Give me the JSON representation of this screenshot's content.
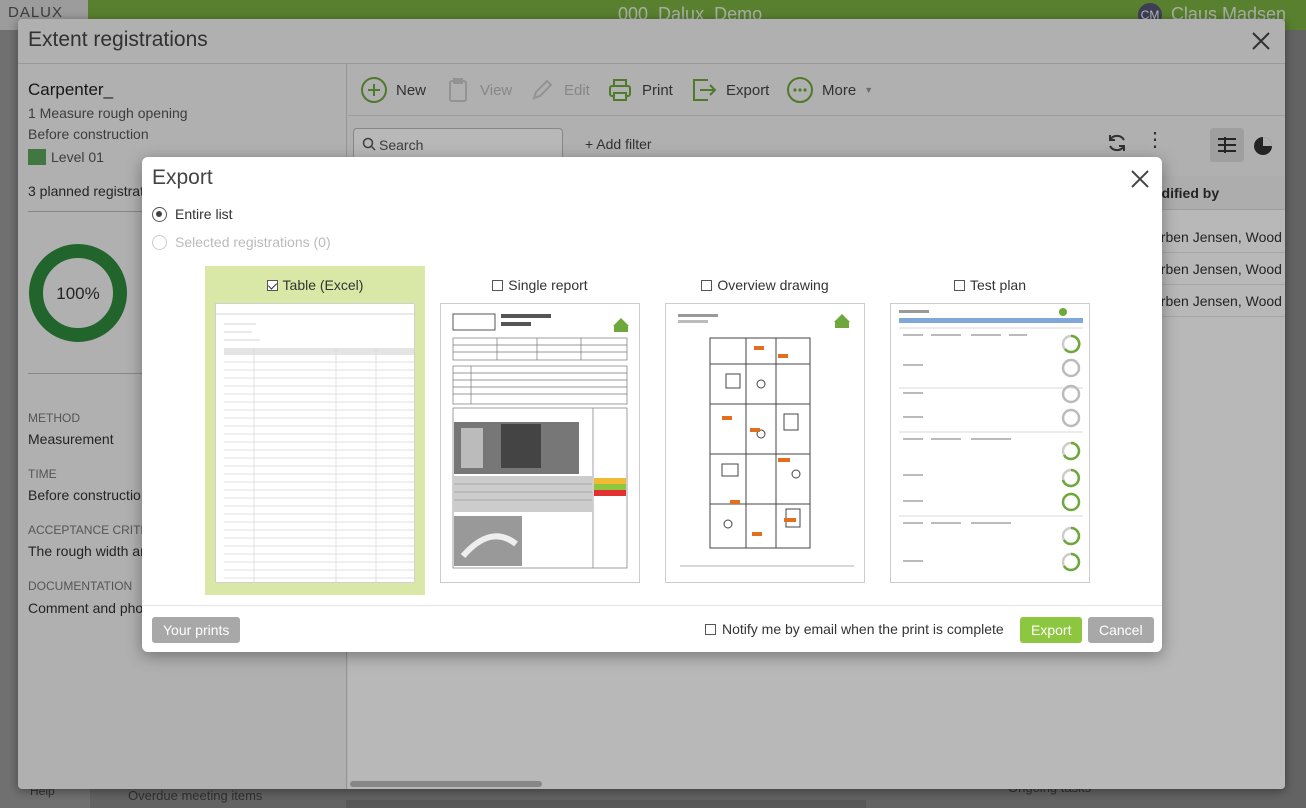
{
  "app": {
    "logo": "DALUX",
    "project": "000_Dalux_Demo",
    "user_initials": "CM",
    "user_name": "Claus Madsen",
    "help": "Help",
    "bottom_item": "Overdue meeting items",
    "bottom_item_right": "Ongoing tasks"
  },
  "window": {
    "title": "Extent registrations"
  },
  "left_pane": {
    "title": "Carpenter_",
    "subtitle": "1 Measure rough opening",
    "phase": "Before construction",
    "level": "Level 01",
    "planned": "3 planned registrat",
    "percent": "100%",
    "percent_value": 100,
    "method_label": "METHOD",
    "method_value": "Measurement",
    "time_label": "TIME",
    "time_value": "Before constructio",
    "acceptance_label": "ACCEPTANCE CRITER",
    "acceptance_value": "The rough width ar",
    "documentation_label": "DOCUMENTATION",
    "documentation_value": "Comment and pho"
  },
  "toolbar": {
    "new": "New",
    "view": "View",
    "edit": "Edit",
    "print": "Print",
    "export": "Export",
    "more": "More"
  },
  "filter": {
    "search_placeholder": "Search",
    "add_filter": "+ Add filter"
  },
  "table": {
    "column_header": "odified by",
    "rows": [
      "orben Jensen, Wood",
      "orben Jensen, Wood",
      "orben Jensen, Wood"
    ]
  },
  "dialog": {
    "title": "Export",
    "radio_entire": "Entire list",
    "radio_selected": "Selected registrations (0)",
    "options": [
      {
        "label": "Table (Excel)",
        "checked": true
      },
      {
        "label": "Single report",
        "checked": false
      },
      {
        "label": "Overview drawing",
        "checked": false
      },
      {
        "label": "Test plan",
        "checked": false
      }
    ],
    "your_prints": "Your prints",
    "notify": "Notify me by email when the print is complete",
    "export_button": "Export",
    "cancel_button": "Cancel"
  },
  "colors": {
    "brand_green": "#7bb241",
    "button_green": "#8dc63f",
    "selected_option": "#d9e8a6",
    "donut": "#2e8b3e"
  }
}
